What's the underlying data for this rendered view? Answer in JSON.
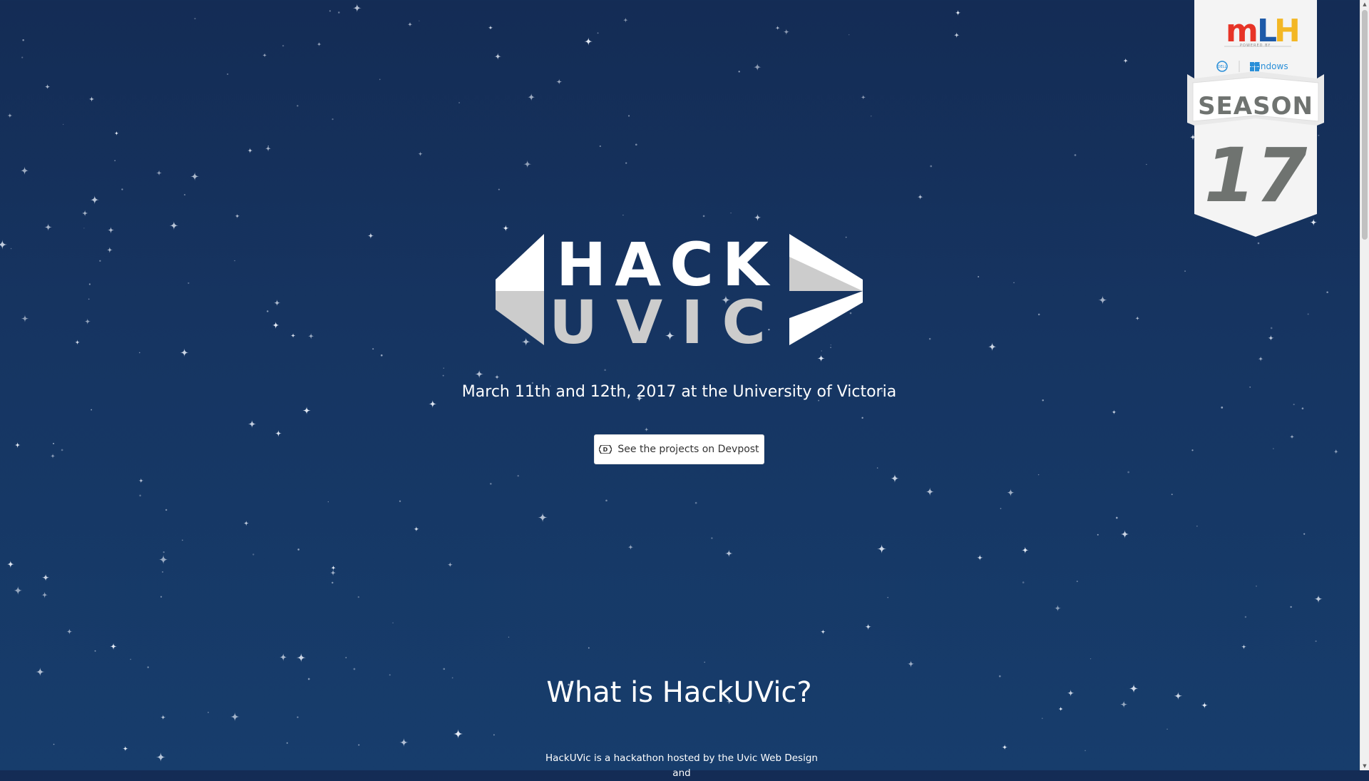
{
  "hero": {
    "logo_top": "HACK",
    "logo_bottom": "UVIC",
    "date_line": "March 11th and 12th, 2017 at the University of Victoria",
    "devpost_button": "See the projects on Devpost",
    "devpost_icon": "devpost-icon"
  },
  "about": {
    "title": "What is HackUVic?",
    "body": "HackUVic is a hackathon hosted by the Uvic Web Design and"
  },
  "mlh_badge": {
    "logo": "MLH",
    "powered_by": "POWERED BY",
    "sponsor_1": "DELL",
    "sponsor_2": "Windows",
    "season_label": "SEASON",
    "season_number": "17"
  },
  "colors": {
    "background": "#163562",
    "accent_white": "#ffffff",
    "logo_grey": "#cccccc",
    "mlh_red": "#e73427",
    "mlh_blue": "#1e5aa8",
    "mlh_yellow": "#f3b725"
  }
}
